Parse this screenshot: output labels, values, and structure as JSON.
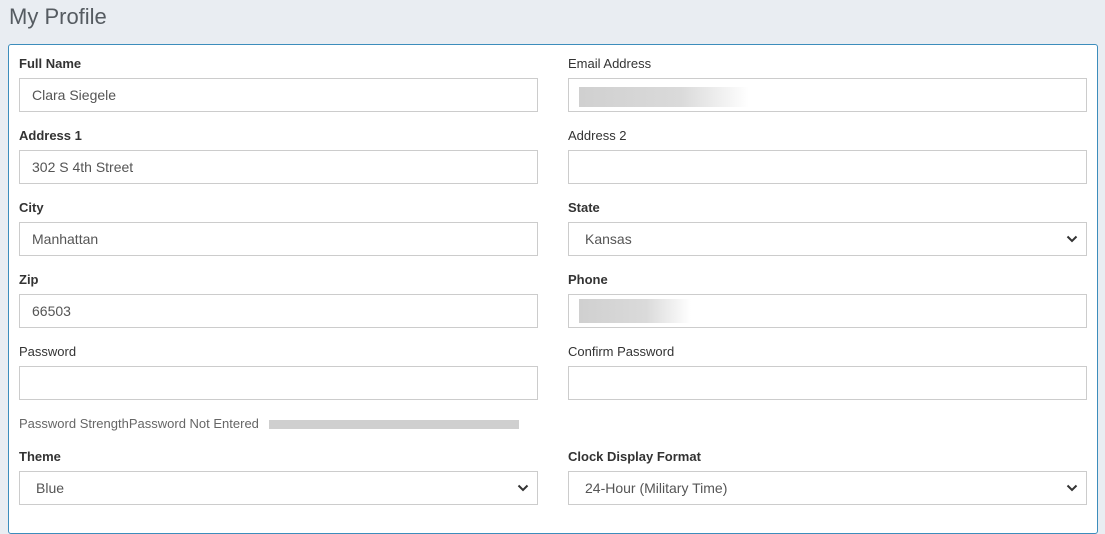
{
  "page": {
    "title": "My Profile"
  },
  "form": {
    "full_name": {
      "label": "Full Name",
      "value": "Clara Siegele"
    },
    "email": {
      "label": "Email Address",
      "value": ""
    },
    "address1": {
      "label": "Address 1",
      "value": "302 S 4th Street"
    },
    "address2": {
      "label": "Address 2",
      "value": ""
    },
    "city": {
      "label": "City",
      "value": "Manhattan"
    },
    "state": {
      "label": "State",
      "selected": "Kansas"
    },
    "zip": {
      "label": "Zip",
      "value": "66503"
    },
    "phone": {
      "label": "Phone",
      "value": ""
    },
    "password": {
      "label": "Password",
      "value": ""
    },
    "confirm_password": {
      "label": "Confirm Password",
      "value": ""
    },
    "password_strength": {
      "label": "Password Strength",
      "status": "Password Not Entered"
    },
    "theme": {
      "label": "Theme",
      "selected": "Blue"
    },
    "clock_format": {
      "label": "Clock Display Format",
      "selected": "24-Hour (Military Time)"
    }
  },
  "icons": {
    "dropdown": "chevron-down-icon"
  },
  "colors": {
    "panel_border": "#3c8dbc",
    "background": "#e9edf2"
  }
}
